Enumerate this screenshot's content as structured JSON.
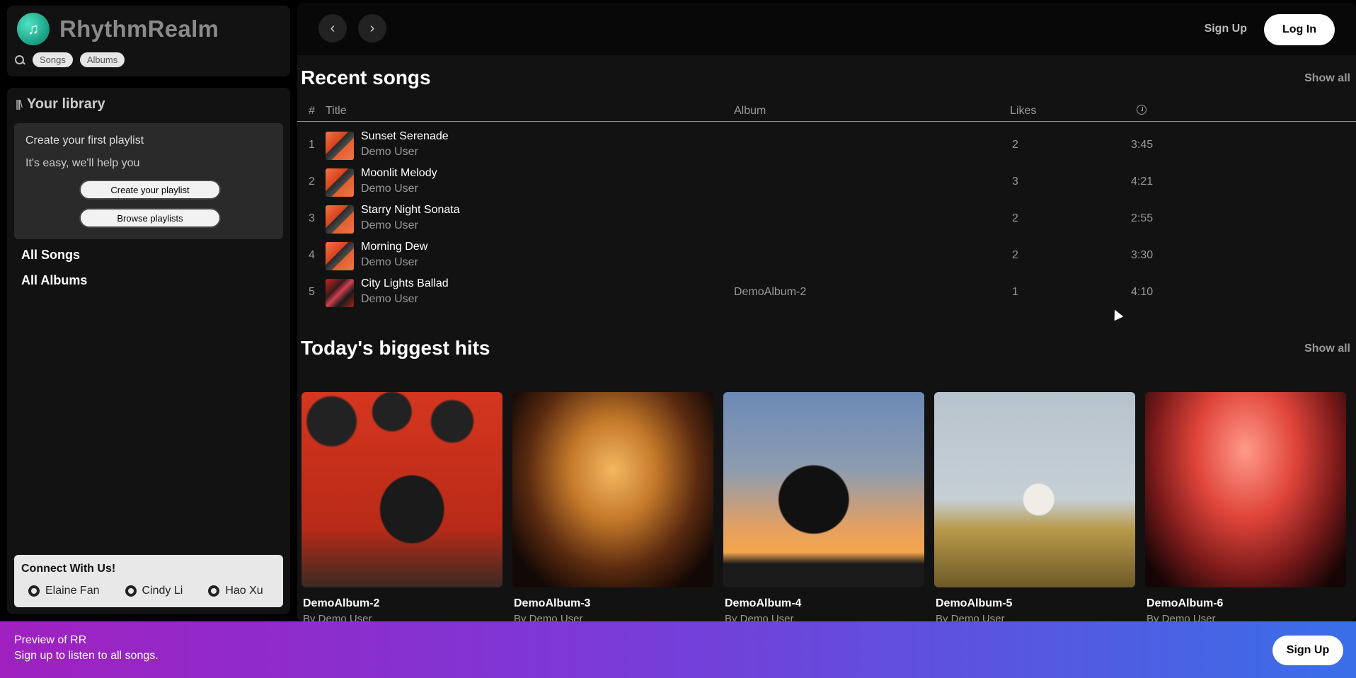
{
  "brand": {
    "name": "RhythmRealm",
    "logo_icon": "music-note-icon"
  },
  "search": {
    "chips": [
      "Songs",
      "Albums"
    ]
  },
  "library": {
    "title": "Your library",
    "create_box": {
      "title": "Create your first playlist",
      "subtitle": "It's easy, we'll help you",
      "create_button": "Create your playlist",
      "browse_button": "Browse playlists"
    },
    "links": [
      "All Songs",
      "All Albums"
    ],
    "connect": {
      "title": "Connect With Us!",
      "people": [
        "Elaine Fan",
        "Cindy Li",
        "Hao Xu"
      ]
    }
  },
  "header": {
    "signup": "Sign Up",
    "login": "Log In"
  },
  "recent": {
    "title": "Recent songs",
    "show_all": "Show all",
    "columns": {
      "num": "#",
      "title": "Title",
      "album": "Album",
      "likes": "Likes"
    },
    "rows": [
      {
        "num": "1",
        "title": "Sunset Serenade",
        "artist": "Demo User",
        "album": "",
        "likes": "2",
        "duration": "3:45"
      },
      {
        "num": "2",
        "title": "Moonlit Melody",
        "artist": "Demo User",
        "album": "",
        "likes": "3",
        "duration": "4:21"
      },
      {
        "num": "3",
        "title": "Starry Night Sonata",
        "artist": "Demo User",
        "album": "",
        "likes": "2",
        "duration": "2:55"
      },
      {
        "num": "4",
        "title": "Morning Dew",
        "artist": "Demo User",
        "album": "",
        "likes": "2",
        "duration": "3:30"
      },
      {
        "num": "5",
        "title": "City Lights Ballad",
        "artist": "Demo User",
        "album": "DemoAlbum-2",
        "likes": "1",
        "duration": "4:10"
      }
    ]
  },
  "hits": {
    "title": "Today's biggest hits",
    "show_all": "Show all",
    "cards": [
      {
        "name": "DemoAlbum-2",
        "by": "By Demo User"
      },
      {
        "name": "DemoAlbum-3",
        "by": "By Demo User"
      },
      {
        "name": "DemoAlbum-4",
        "by": "By Demo User"
      },
      {
        "name": "DemoAlbum-5",
        "by": "By Demo User"
      },
      {
        "name": "DemoAlbum-6",
        "by": "By Demo User"
      }
    ]
  },
  "banner": {
    "title": "Preview of RR",
    "subtitle": "Sign up to listen to all songs.",
    "button": "Sign Up"
  }
}
